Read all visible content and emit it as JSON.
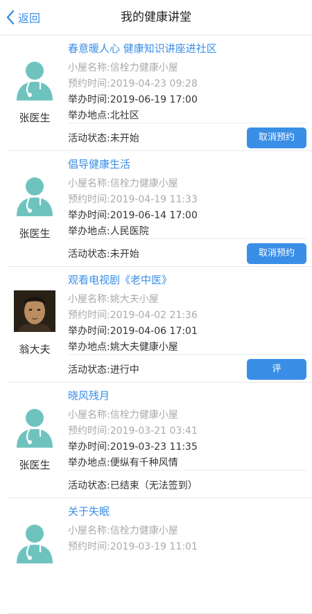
{
  "header": {
    "back_label": "返回",
    "title": "我的健康讲堂"
  },
  "colors": {
    "accent": "#3a8ee6",
    "avatar_teal": "#6fc3bf"
  },
  "cards": [
    {
      "title": "春意暖人心 健康知识讲座进社区",
      "avatar": "doctor-icon",
      "doctor": "张医生",
      "cabin_label": "小屋名称:",
      "cabin": "信栓力健康小屋",
      "booking_label": "预约时间:",
      "booking_time": "2019-04-23 09:28",
      "hold_label": "举办时间:",
      "hold_time": "2019-06-19 17:00",
      "place_label": "举办地点:",
      "place": "北社区",
      "status_label": "活动状态:",
      "status": "未开始",
      "button": "取消预约"
    },
    {
      "title": "倡导健康生活",
      "avatar": "doctor-icon",
      "doctor": "张医生",
      "cabin_label": "小屋名称:",
      "cabin": "信栓力健康小屋",
      "booking_label": "预约时间:",
      "booking_time": "2019-04-19 11:33",
      "hold_label": "举办时间:",
      "hold_time": "2019-06-14 17:00",
      "place_label": "举办地点:",
      "place": "人民医院",
      "status_label": "活动状态:",
      "status": "未开始",
      "button": "取消预约"
    },
    {
      "title": "观看电视剧《老中医》",
      "avatar": "photo",
      "doctor": "翁大夫",
      "cabin_label": "小屋名称:",
      "cabin": "姚大夫小屋",
      "booking_label": "预约时间:",
      "booking_time": "2019-04-02 21:36",
      "hold_label": "举办时间:",
      "hold_time": "2019-04-06 17:01",
      "place_label": "举办地点:",
      "place": "姚大夫健康小屋",
      "status_label": "活动状态:",
      "status": "进行中",
      "button": "评价"
    },
    {
      "title": "晓风残月",
      "avatar": "doctor-icon",
      "doctor": "张医生",
      "cabin_label": "小屋名称:",
      "cabin": "信栓力健康小屋",
      "booking_label": "预约时间:",
      "booking_time": "2019-03-21 03:41",
      "hold_label": "举办时间:",
      "hold_time": "2019-03-23 11:35",
      "place_label": "举办地点:",
      "place": "便纵有千种风情",
      "status_label": "活动状态:",
      "status": "已结束（无法签到）",
      "button": ""
    },
    {
      "title": "关于失眠",
      "avatar": "doctor-icon",
      "doctor": "",
      "cabin_label": "小屋名称:",
      "cabin": "信栓力健康小屋",
      "booking_label": "预约时间:",
      "booking_time": "2019-03-19 11:01",
      "hold_label": "",
      "hold_time": "",
      "place_label": "",
      "place": "",
      "status_label": "",
      "status": "",
      "button": ""
    }
  ]
}
